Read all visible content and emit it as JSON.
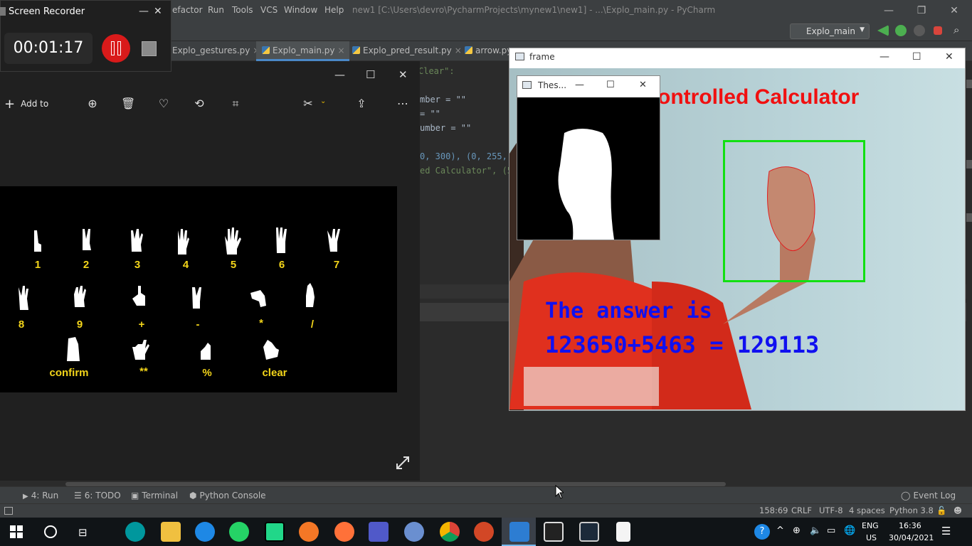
{
  "ide": {
    "menu": [
      "efactor",
      "Run",
      "Tools",
      "VCS",
      "Window",
      "Help"
    ],
    "title": "new1 [C:\\Users\\devro\\PycharmProjects\\mynew1\\new1] - ...\\Explo_main.py - PyCharm",
    "run_config": "Explo_main",
    "tabs": [
      "Explo_gestures.py",
      "Explo_main.py",
      "Explo_pred_result.py",
      "arrow.py"
    ],
    "active_tab": "Explo_main.py",
    "code_lines": [
      "Clear\":",
      "mber = \"\"",
      "= \"\"",
      "umber = \"\"",
      "0, 300), (0, 255,",
      "ed Calculator\", (5"
    ]
  },
  "recorder": {
    "title": "Screen Recorder",
    "time": "00:01:17"
  },
  "photos": {
    "add_to": "Add to",
    "gestures_row1": [
      "1",
      "2",
      "3",
      "4",
      "5",
      "6",
      "7"
    ],
    "gestures_row2": [
      "8",
      "9",
      "+",
      "-",
      "*",
      "/"
    ],
    "gestures_row3": [
      "confirm",
      "**",
      "%",
      "clear"
    ]
  },
  "frame": {
    "title": "frame",
    "overlay_title": "ontrolled Calculator",
    "answer_label": "The answer is",
    "answer_value": "123650+5463 = 129113"
  },
  "thresh": {
    "title": "Thes..."
  },
  "tool_tabs": [
    "4: Run",
    "6: TODO",
    "Terminal",
    "Python Console"
  ],
  "event_log": "Event Log",
  "status": {
    "position": "158:69",
    "line_sep": "CRLF",
    "encoding": "UTF-8",
    "indent": "4 spaces",
    "interpreter": "Python 3.8"
  },
  "taskbar": {
    "lang_top": "ENG",
    "lang_bottom": "US",
    "time": "16:36",
    "date": "30/04/2021"
  }
}
